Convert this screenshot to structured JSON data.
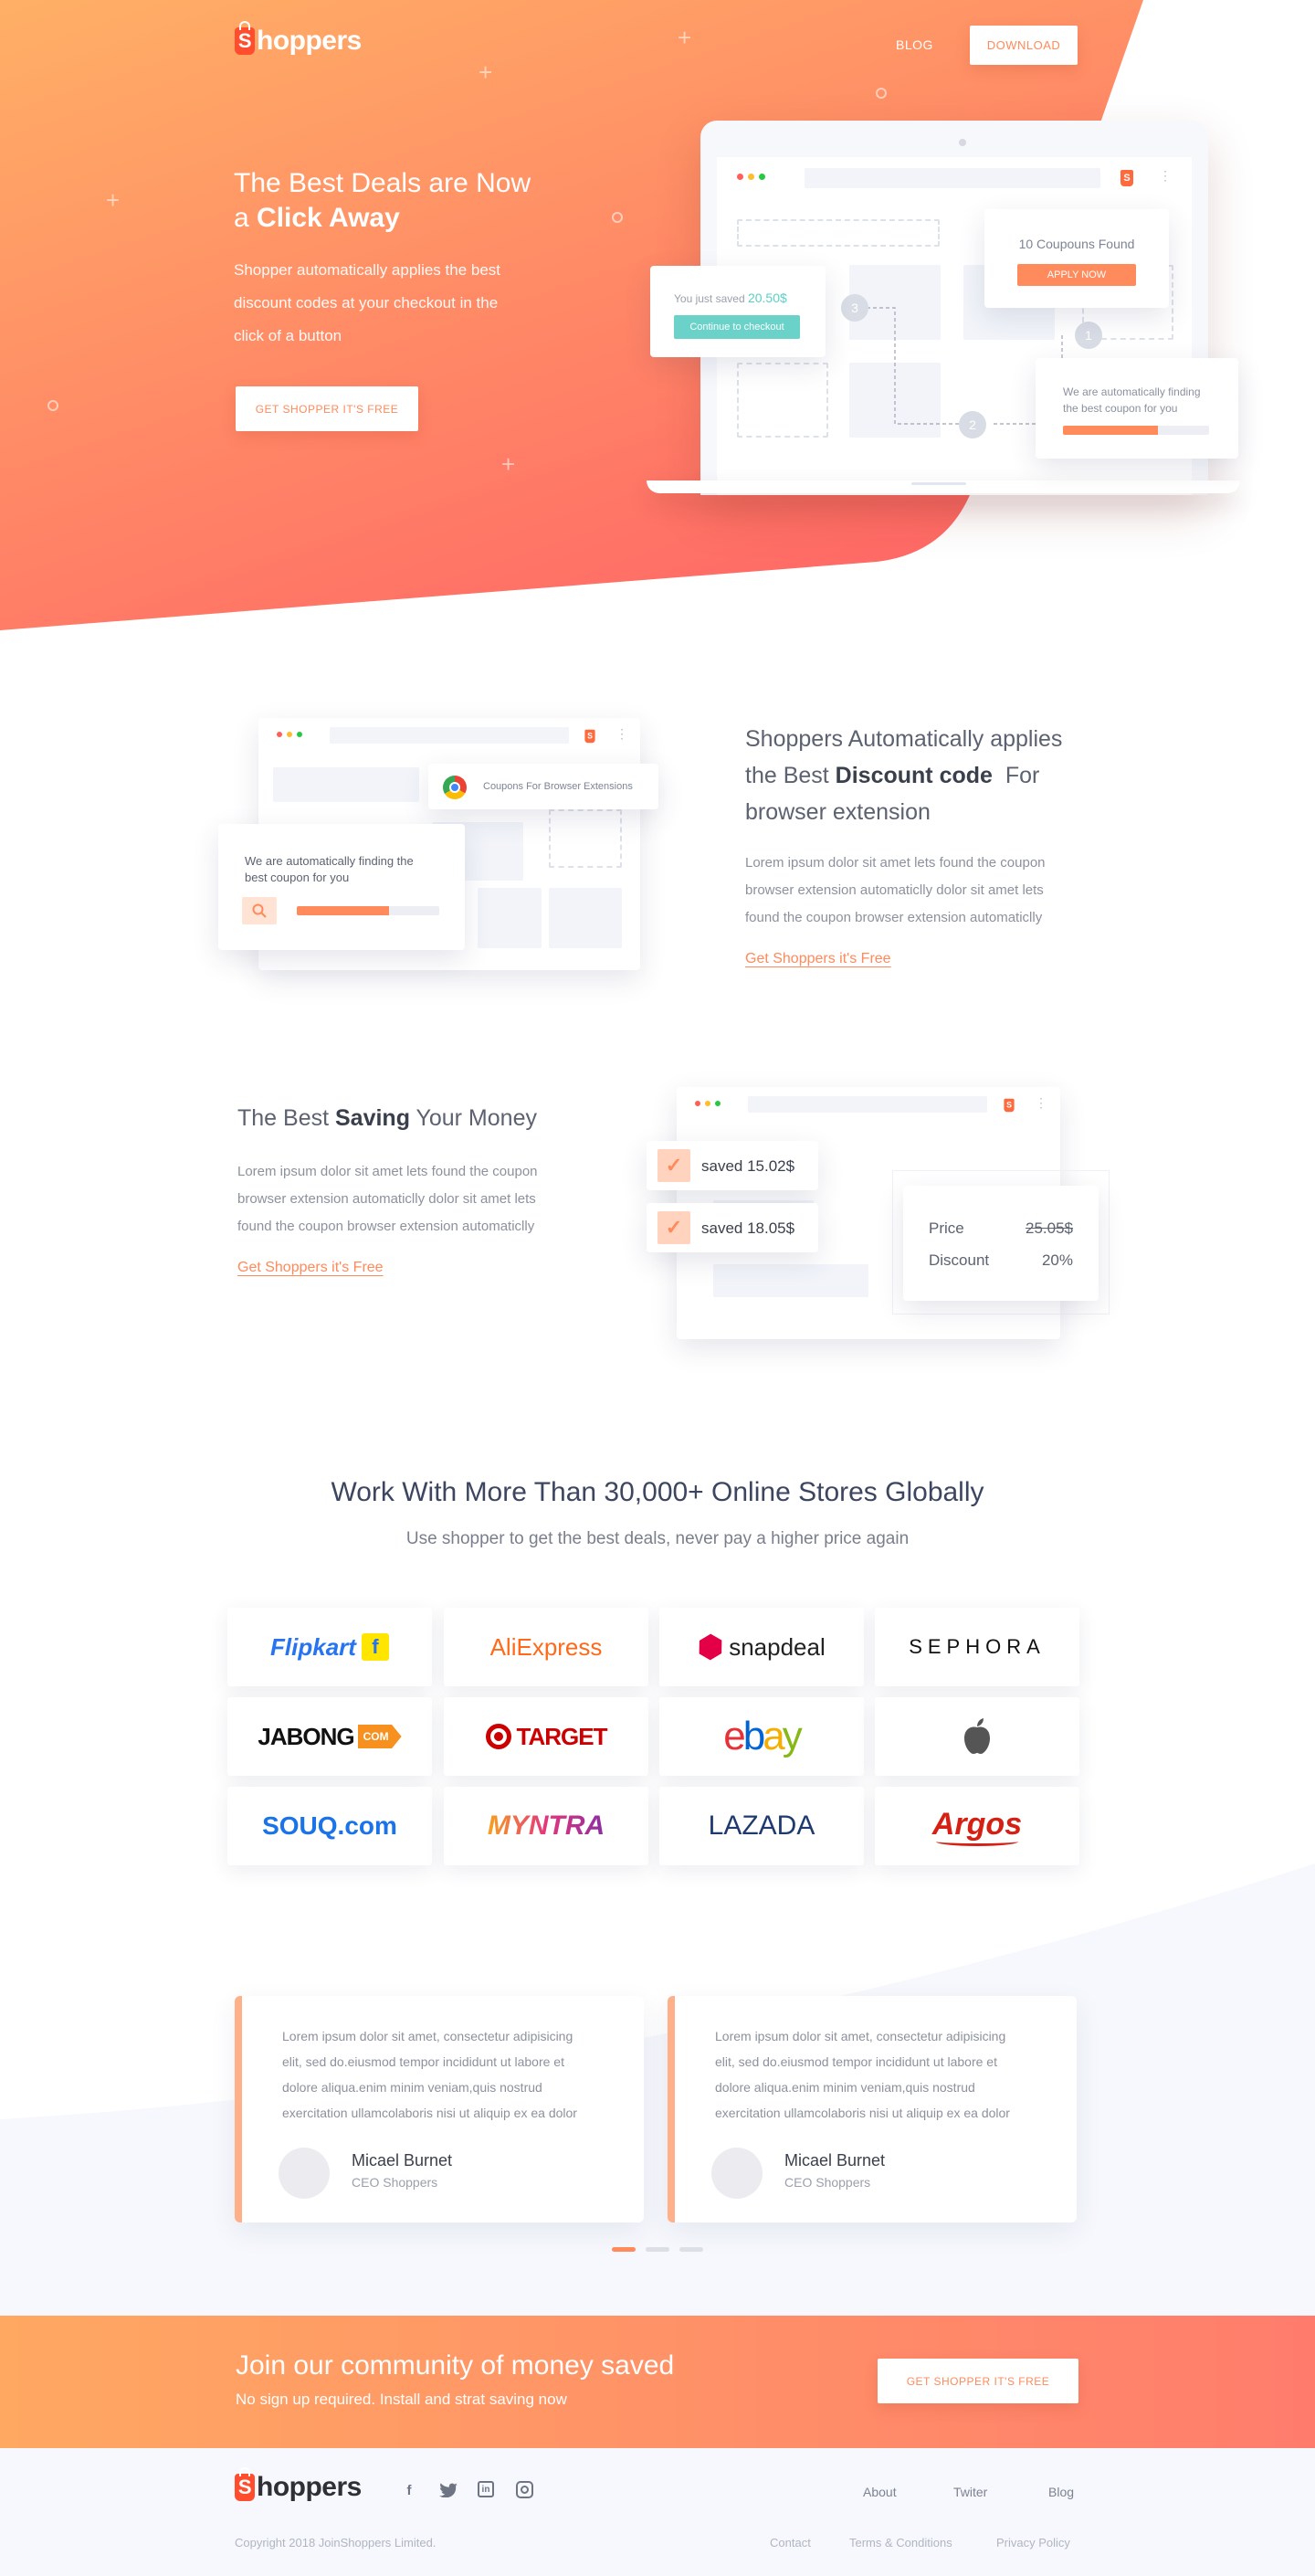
{
  "brand": {
    "name": "Shoppers",
    "logo_letter": "S"
  },
  "nav": {
    "blog": "BLOG",
    "download": "DOWNLOAD"
  },
  "hero": {
    "title_line1": "The Best Deals are Now",
    "title_line2_prefix": "a ",
    "title_line2_bold": "Click Away",
    "desc_lines": [
      "Shopper automatically applies the best",
      "discount codes at your checkout in the",
      "click of a button"
    ],
    "cta": "GET SHOPPER IT'S FREE"
  },
  "mockup": {
    "coupons_found": "10 Coupouns Found",
    "apply_now": "APPLY NOW",
    "saved_prefix": "You just saved",
    "saved_amount": "20.50$",
    "continue_checkout": "Continue to checkout",
    "finding_line1": "We are automatically finding",
    "finding_line2": "the best coupon for you",
    "finding_progress": 0.65,
    "steps": [
      "1",
      "2",
      "3"
    ]
  },
  "feature1": {
    "title_line1": "Shoppers Automatically applies",
    "title_line2_prefix": "the Best ",
    "title_line2_bold": "Discount code",
    "title_line2_suffix": "  For",
    "title_line3": "browser extension",
    "desc_lines": [
      "Lorem ipsum dolor sit amet lets found the coupon",
      "browser extension automaticlly dolor sit amet lets",
      "found the coupon browser extension automaticlly"
    ],
    "link": "Get Shoppers it's Free",
    "ext_label": "Coupons For Browser Extensions",
    "finding_line1": "We are automatically finding the",
    "finding_line2": "best coupon for you",
    "finding_progress": 0.65
  },
  "feature2": {
    "title_prefix": "The Best ",
    "title_bold": "Saving",
    "title_suffix": " Your Money",
    "desc_lines": [
      "Lorem ipsum dolor sit amet lets found the coupon",
      "browser extension automaticlly dolor sit amet lets",
      "found the coupon browser extension automaticlly"
    ],
    "link": "Get Shoppers it's Free",
    "saved1": "saved 15.02$",
    "saved2": "saved 18.05$",
    "price_label": "Price",
    "price_value": "25.05$",
    "discount_label": "Discount",
    "discount_value": "20%"
  },
  "stores": {
    "title": "Work With More Than 30,000+ Online Stores Globally",
    "subtitle": "Use shopper to get the best deals, never pay a higher price again",
    "items": [
      {
        "name": "Flipkart",
        "color": "#2874f0"
      },
      {
        "name": "AliExpress",
        "color": "#ff6a1a"
      },
      {
        "name": "snapdeal",
        "color": "#222222"
      },
      {
        "name": "SEPHORA",
        "color": "#111111"
      },
      {
        "name": "JABONG",
        "color": "#111111"
      },
      {
        "name": "TARGET",
        "color": "#cc0000"
      },
      {
        "name": "ebay",
        "color": "#e53238"
      },
      {
        "name": "",
        "color": "#555555"
      },
      {
        "name": "SOUQ.com",
        "color": "#1a73e8"
      },
      {
        "name": "MYNTRA",
        "color": "#e5357c"
      },
      {
        "name": "LAZADA",
        "color": "#1f3a6e"
      },
      {
        "name": "Argos",
        "color": "#d42114"
      }
    ]
  },
  "testimonials": [
    {
      "text_lines": [
        "Lorem ipsum dolor sit amet, consectetur adipisicing",
        "elit, sed do.eiusmod tempor incididunt ut labore et",
        "dolore aliqua.enim minim veniam,quis nostrud",
        "exercitation ullamcolaboris nisi ut aliquip ex ea dolor"
      ],
      "name": "Micael Burnet",
      "role": "CEO Shoppers"
    },
    {
      "text_lines": [
        "Lorem ipsum dolor sit amet, consectetur adipisicing",
        "elit, sed do.eiusmod tempor incididunt ut labore et",
        "dolore aliqua.enim minim veniam,quis nostrud",
        "exercitation ullamcolaboris nisi ut aliquip ex ea dolor"
      ],
      "name": "Micael Burnet",
      "role": "CEO Shoppers"
    }
  ],
  "cta": {
    "title": "Join our community of money saved",
    "subtitle": "No sign up required. Install and strat saving now",
    "button": "GET SHOPPER IT'S FREE"
  },
  "footer": {
    "links_top": [
      "About",
      "Twiter",
      "Blog"
    ],
    "links_bottom": [
      "Contact",
      "Terms & Conditions",
      "Privacy Policy"
    ],
    "copyright": "Copyright 2018 JoinShoppers Limited.",
    "social_icons": [
      "facebook-icon",
      "twitter-icon",
      "linkedin-icon",
      "instagram-icon"
    ]
  },
  "colors": {
    "accent": "#ff8a5b",
    "gradient_start": "#ffae63",
    "gradient_end": "#ff6a6a",
    "teal": "#5ccfc4"
  }
}
